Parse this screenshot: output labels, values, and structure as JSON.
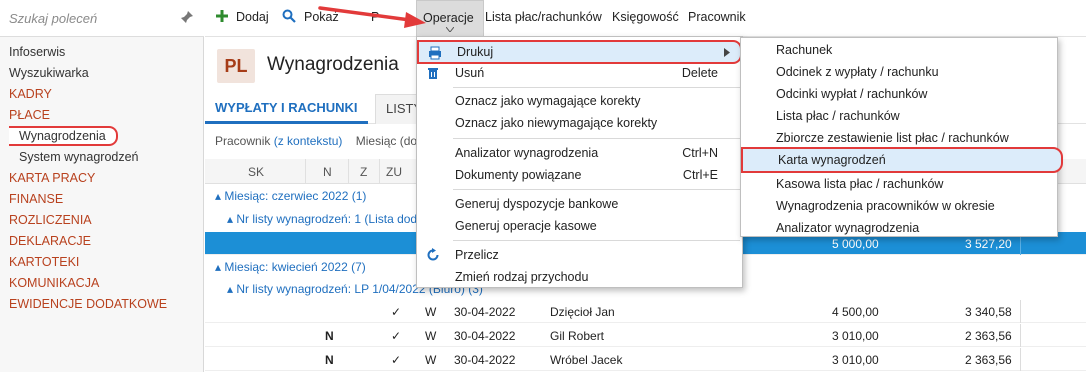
{
  "sidebar": {
    "search_placeholder": "Szukaj poleceń",
    "items": [
      {
        "label": "Infoserwis"
      },
      {
        "label": "Wyszukiwarka"
      },
      {
        "label": "KADRY"
      },
      {
        "label": "PŁACE"
      },
      {
        "label": "Wynagrodzenia"
      },
      {
        "label": "System wynagrodzeń"
      },
      {
        "label": "KARTA PRACY"
      },
      {
        "label": "FINANSE"
      },
      {
        "label": "ROZLICZENIA"
      },
      {
        "label": "DEKLARACJE"
      },
      {
        "label": "KARTOTEKI"
      },
      {
        "label": "KOMUNIKACJA"
      },
      {
        "label": "EWIDENCJE DODATKOWE"
      }
    ]
  },
  "toolbar": {
    "add_label": "Dodaj",
    "show_label": "Pokaż",
    "hidden_label": "P",
    "operations_label": "Operacje",
    "payroll_label": "Lista płac/rachunków",
    "accounting_label": "Księgowość",
    "employee_label": "Pracownik"
  },
  "header": {
    "badge": "PL",
    "title": "Wynagrodzenia"
  },
  "tabs": [
    {
      "label": "WYPŁATY I RACHUNKI"
    },
    {
      "label": "LISTY"
    }
  ],
  "filters": {
    "employee_label": "Pracownik",
    "employee_value": "(z kontekstu)",
    "month_label": "Miesiąc (do"
  },
  "grid": {
    "headers": [
      "SK",
      "N",
      "Z",
      "ZU"
    ],
    "groups": [
      "Miesiąc: czerwiec 2022 (1)",
      "Nr listy wynagrodzeń: 1 (Lista doda",
      "Miesiąc: kwiecień 2022 (7)",
      "Nr listy wynagrodzeń: LP 1/04/2022 (Biuro) (3)"
    ],
    "blue_row": {
      "amount1": "5 000,00",
      "amount2": "3 527,20"
    },
    "rows": [
      {
        "n": "",
        "check": "✓",
        "w": "W",
        "date": "30-04-2022",
        "name": "Dzięcioł Jan",
        "amount1": "4 500,00",
        "amount2": "3 340,58"
      },
      {
        "n": "N",
        "check": "✓",
        "w": "W",
        "date": "30-04-2022",
        "name": "Gil Robert",
        "amount1": "3 010,00",
        "amount2": "2 363,56"
      },
      {
        "n": "N",
        "check": "✓",
        "w": "W",
        "date": "30-04-2022",
        "name": "Wróbel Jacek",
        "amount1": "3 010,00",
        "amount2": "2 363,56"
      }
    ]
  },
  "menu": {
    "items": [
      {
        "label": "Drukuj",
        "shortcut": ""
      },
      {
        "label": "Usuń",
        "shortcut": "Delete"
      },
      {
        "label": "Oznacz jako wymagające korekty",
        "shortcut": ""
      },
      {
        "label": "Oznacz jako niewymagające korekty",
        "shortcut": ""
      },
      {
        "label": "Analizator wynagrodzenia",
        "shortcut": "Ctrl+N"
      },
      {
        "label": "Dokumenty powiązane",
        "shortcut": "Ctrl+E"
      },
      {
        "label": "Generuj dyspozycje bankowe",
        "shortcut": ""
      },
      {
        "label": "Generuj operacje kasowe",
        "shortcut": ""
      },
      {
        "label": "Przelicz",
        "shortcut": ""
      },
      {
        "label": "Zmień rodzaj przychodu",
        "shortcut": ""
      }
    ]
  },
  "submenu": {
    "items": [
      {
        "label": "Rachunek"
      },
      {
        "label": "Odcinek z wypłaty / rachunku"
      },
      {
        "label": "Odcinki wypłat / rachunków"
      },
      {
        "label": "Lista płac / rachunków"
      },
      {
        "label": "Zbiorcze zestawienie list płac / rachunków"
      },
      {
        "label": "Karta wynagrodzeń"
      },
      {
        "label": "Kasowa lista płac / rachunków"
      },
      {
        "label": "Wynagrodzenia pracowników w okresie"
      },
      {
        "label": "Analizator wynagrodzenia"
      }
    ]
  },
  "colors": {
    "accent": "#1f6fbf",
    "section": "#b8411e",
    "highlight_border": "#e23a3a",
    "selected_row": "#1c8fd6"
  }
}
